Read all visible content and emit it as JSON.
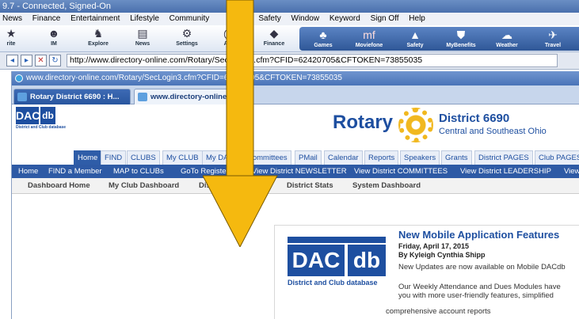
{
  "window": {
    "title": "9.7 - Connected, Signed-On"
  },
  "menu": [
    "News",
    "Finance",
    "Entertainment",
    "Lifestyle",
    "Community",
    "es",
    "Safety",
    "Window",
    "Keyword",
    "Sign Off",
    "Help"
  ],
  "toolbar": {
    "left": [
      {
        "label": "rite",
        "icon": "star-icon"
      },
      {
        "label": "IM",
        "icon": "im-icon"
      },
      {
        "label": "Explore",
        "icon": "explore-icon"
      },
      {
        "label": "News",
        "icon": "news-icon"
      },
      {
        "label": "Settings",
        "icon": "gear-icon"
      },
      {
        "label": "AOL",
        "icon": "aol-icon"
      },
      {
        "label": "Finance",
        "icon": "finance-icon"
      }
    ],
    "right": [
      {
        "label": "Games",
        "icon": "games-icon"
      },
      {
        "label": "Moviefone",
        "icon": "moviefone-icon"
      },
      {
        "label": "Safety",
        "icon": "safety-icon"
      },
      {
        "label": "MyBenefits",
        "icon": "benefits-icon"
      },
      {
        "label": "Weather",
        "icon": "weather-icon"
      },
      {
        "label": "Travel",
        "icon": "plane-icon"
      }
    ]
  },
  "address": {
    "url": "http://www.directory-online.com/Rotary/SecLogin3.cfm?CFID=62420705&CFTOKEN=73855035"
  },
  "inner": {
    "title": "www.directory-online.com/Rotary/SecLogin3.cfm?CFID=62420705&CFTOKEN=73855035",
    "tabs": [
      "Rotary District 6690 : H...",
      "www.directory-online.com"
    ]
  },
  "site": {
    "logo_text": [
      "DAC",
      "db"
    ],
    "logo_caption": "District and Club database",
    "rotary": "Rotary",
    "district": "District 6690",
    "district_sub": "Central and Southeast Ohio"
  },
  "navtabs": [
    "Home",
    "FIND",
    "CLUBS",
    "My CLUB",
    "My DATA",
    "Committees",
    "PMail",
    "Calendar",
    "Reports",
    "Speakers",
    "Grants",
    "District PAGES",
    "Club PAGES"
  ],
  "bluenav": [
    "Home",
    "FIND a Member",
    "MAP to CLUBs",
    "GoTo RegisterME",
    "View District NEWSLETTER",
    "View District COMMITTEES",
    "View District LEADERSHIP",
    "View"
  ],
  "dashbar": [
    "Dashboard Home",
    "My Club Dashboard",
    "District Dashboard",
    "District Stats",
    "System Dashboard"
  ],
  "news": {
    "title": "New Mobile Application Features",
    "date": "Friday, April 17, 2015",
    "by": "By Kyleigh Cynthia Shipp",
    "p1": "New Updates are now available on Mobile DACdb",
    "p2": "Our Weekly Attendance and Dues Modules have",
    "p3": "you with more user-friendly features, simplified",
    "p4": "comprehensive account reports"
  },
  "colors": {
    "accent": "#1e4fa0",
    "nav": "#2e5aa5",
    "arrow": "#f5b90f"
  }
}
